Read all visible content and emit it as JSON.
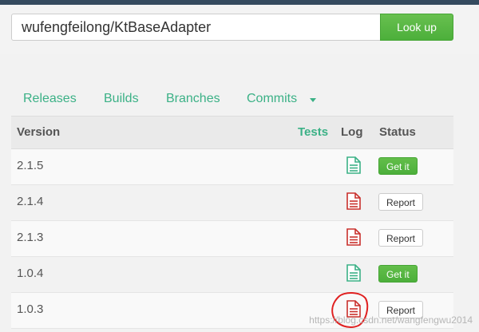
{
  "search": {
    "value": "wufengfeilong/KtBaseAdapter"
  },
  "lookup": {
    "label": "Look up"
  },
  "tabs": {
    "releases": "Releases",
    "builds": "Builds",
    "branches": "Branches",
    "commits": "Commits"
  },
  "table": {
    "headers": {
      "version": "Version",
      "tests": "Tests",
      "log": "Log",
      "status": "Status"
    },
    "rows": [
      {
        "version": "2.1.5",
        "log_status": "ok",
        "status_label": "Get it"
      },
      {
        "version": "2.1.4",
        "log_status": "error",
        "status_label": "Report"
      },
      {
        "version": "2.1.3",
        "log_status": "error",
        "status_label": "Report"
      },
      {
        "version": "1.0.4",
        "log_status": "ok",
        "status_label": "Get it"
      },
      {
        "version": "1.0.3",
        "log_status": "error",
        "status_label": "Report"
      }
    ]
  },
  "colors": {
    "accent": "#3bb186",
    "ok_icon": "#3bb186",
    "error_icon": "#c9302c",
    "button_green": "#4caf3b"
  },
  "watermark": "https://blog.csdn.net/wangfengwu2014"
}
